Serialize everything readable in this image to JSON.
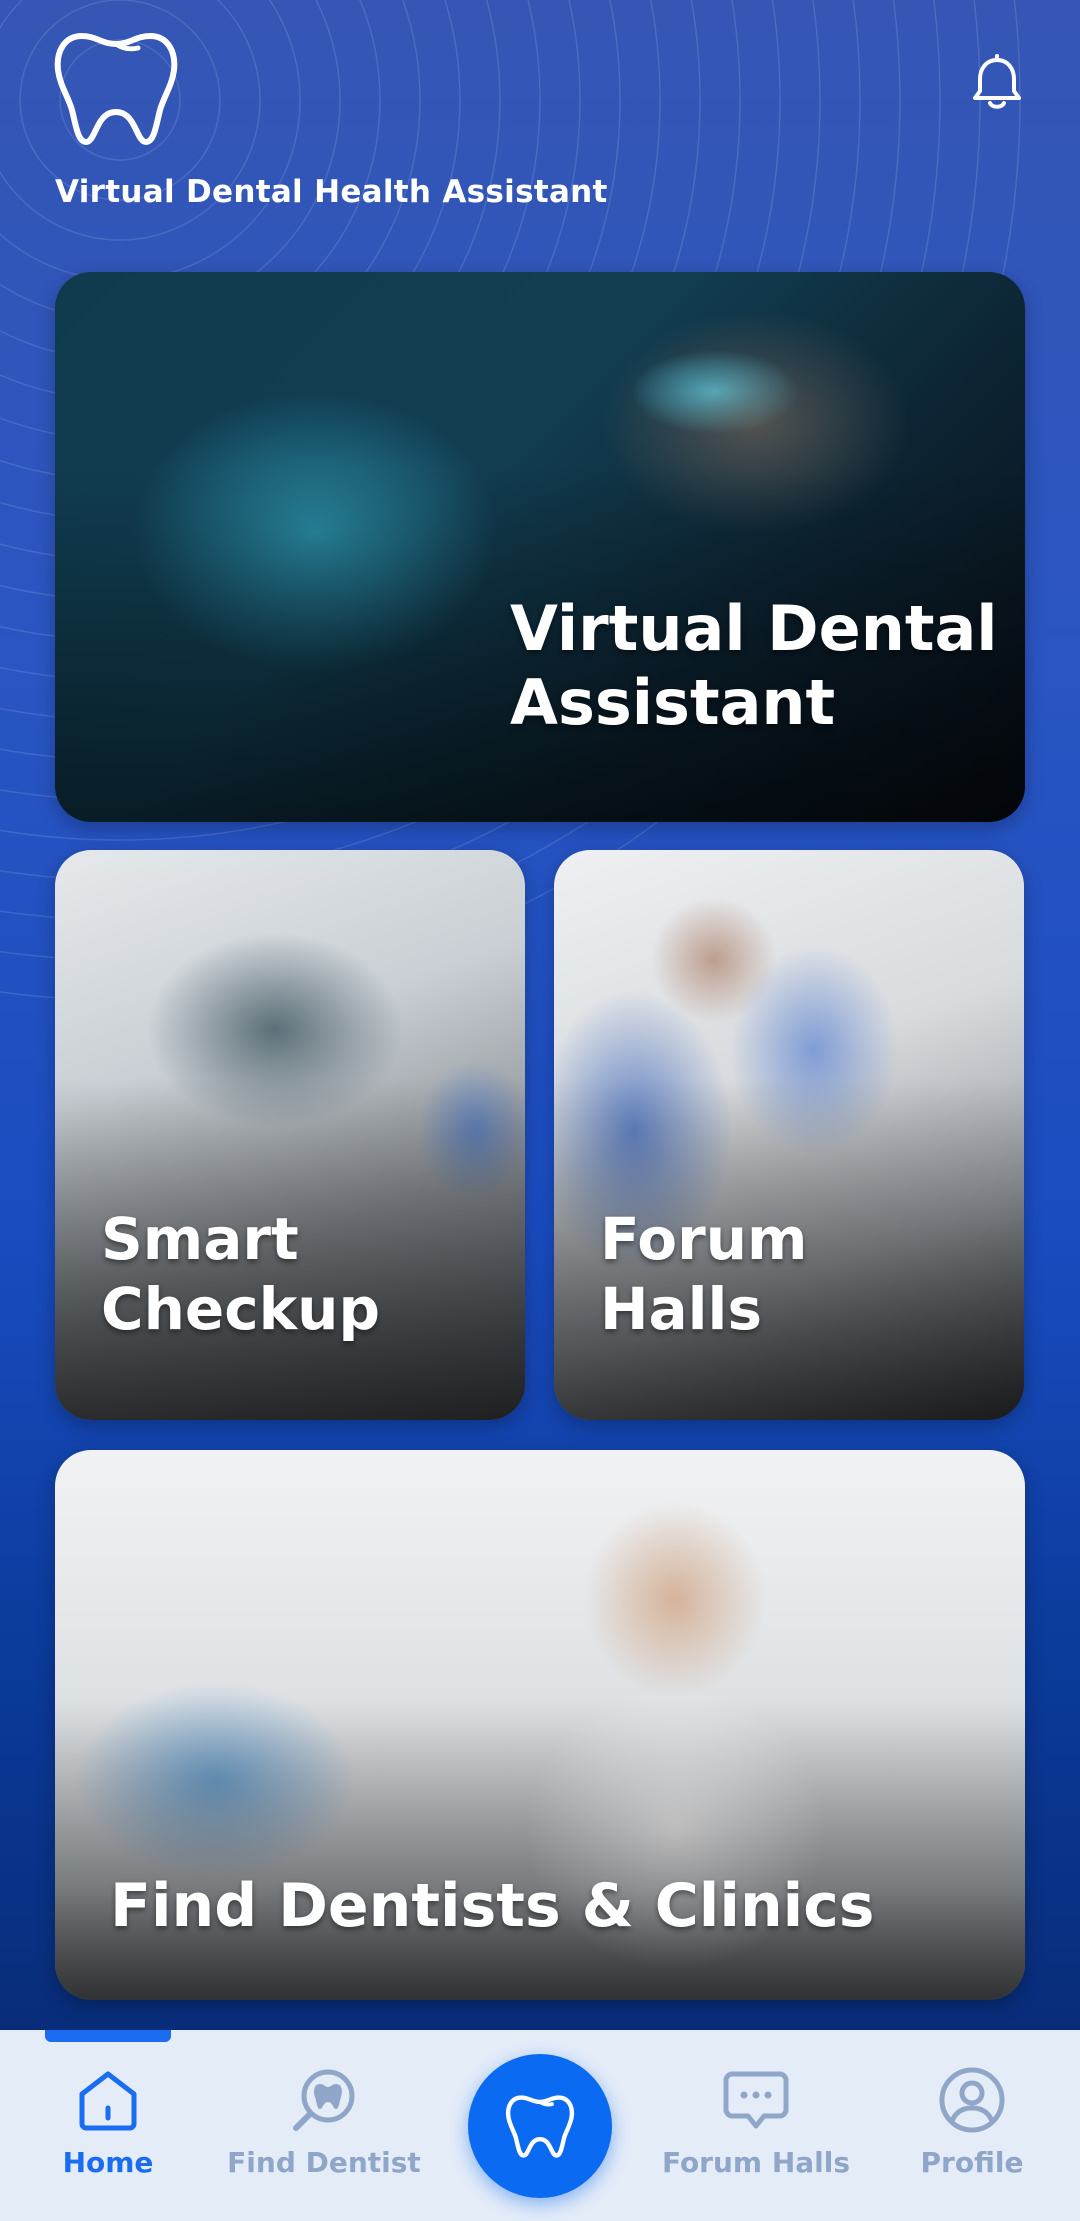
{
  "header": {
    "app_title": "Virtual Dental Health Assistant",
    "logo_icon": "tooth-logo-icon",
    "notification_icon": "bell-icon"
  },
  "cards": {
    "virtual_assistant": {
      "title_line1": "Virtual Dental",
      "title_line2": "Assistant"
    },
    "smart_checkup": {
      "title_line1": "Smart",
      "title_line2": "Checkup"
    },
    "forum_halls": {
      "title_line1": "Forum",
      "title_line2": "Halls"
    },
    "find_dentists": {
      "title": "Find Dentists & Clinics"
    }
  },
  "bottom_nav": {
    "items": [
      {
        "label": "Home",
        "icon": "home-icon",
        "active": true
      },
      {
        "label": "Find Dentist",
        "icon": "search-tooth-icon",
        "active": false
      },
      {
        "label": "Forum Halls",
        "icon": "chat-bubble-icon",
        "active": false
      },
      {
        "label": "Profile",
        "icon": "user-circle-icon",
        "active": false
      }
    ],
    "center_icon": "tooth-icon"
  },
  "colors": {
    "accent": "#1a6cf0",
    "center_button": "#0a6af2",
    "nav_background": "#e4ecf8",
    "nav_inactive": "#8fa6c8",
    "background_top": "#3556b4",
    "background_bottom": "#0a2a6e"
  }
}
